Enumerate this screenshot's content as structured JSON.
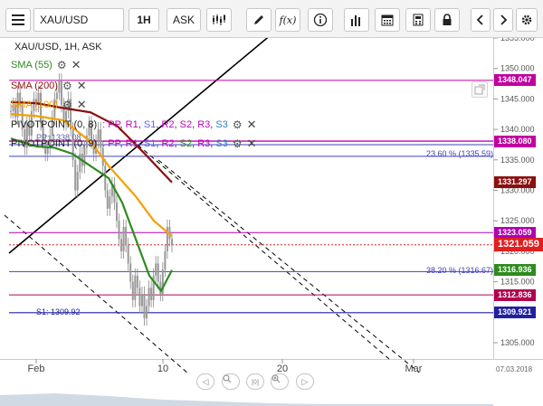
{
  "toolbar": {
    "symbol": "XAU/USD",
    "timeframe": "1H",
    "price_type": "ASK",
    "fx_label": "f(x)"
  },
  "chart_title": "XAU/USD, 1H, ASK",
  "indicators": [
    {
      "label": "SMA (55)",
      "color": "#2e8b1e"
    },
    {
      "label": "SMA (200)",
      "color": "#8b1010"
    },
    {
      "label": "SMA (100)",
      "color": "#f5a000"
    },
    {
      "label_prefix": "PIVOTPOINT (0, 8)",
      "parts": [
        ":",
        "PP",
        "R1",
        "S1",
        "R2",
        "S2",
        "R3",
        "S3"
      ],
      "color": "#c000c0"
    },
    {
      "label_prefix": "PIVOTPOINT (0, 9)",
      "parts": [
        ":",
        "PP",
        "R1",
        "S1",
        "R2",
        "S2",
        "R3",
        "S3"
      ],
      "color": "#4040c0"
    }
  ],
  "pivot_parts_colors": {
    ":": "#c000c0",
    "PP": "#c000c0",
    "R1": "#c000c0",
    "S1": "#6060ff",
    "R2": "#c000c0",
    "S2": "#c000c0",
    "R3": "#c000c0",
    "S3": "#3080c0"
  },
  "annotations": {
    "pp_label": "PP: 1338.08",
    "s1_label": "S1: 1309.92",
    "fib_2360": "23.60 % (1335.59)",
    "fib_3820": "38.20 % (1316.67)"
  },
  "price_axis": {
    "ticks": [
      "1355.000",
      "1350.000",
      "1345.000",
      "1340.000",
      "1335.000",
      "1330.000",
      "1325.000",
      "1320.000",
      "1315.000",
      "1310.000",
      "1305.000"
    ],
    "tick_values": [
      1355,
      1350,
      1345,
      1340,
      1335,
      1330,
      1325,
      1320,
      1315,
      1310,
      1305
    ]
  },
  "price_labels": [
    {
      "value": "1348.047",
      "price": 1348.047,
      "color": "#c000a0"
    },
    {
      "value": "1338.080",
      "price": 1338.08,
      "color": "#c000a0"
    },
    {
      "value": "1331.297",
      "price": 1331.297,
      "color": "#8b1010"
    },
    {
      "value": "1323.059",
      "price": 1323.059,
      "color": "#b000b0"
    },
    {
      "value": "1321.059",
      "price": 1321.059,
      "color": "#e02020",
      "current": true
    },
    {
      "value": "1316.936",
      "price": 1316.936,
      "color": "#2e8b1e"
    },
    {
      "value": "1312.836",
      "price": 1312.836,
      "color": "#b00050"
    },
    {
      "value": "1309.921",
      "price": 1309.921,
      "color": "#2020a0"
    }
  ],
  "time_axis": {
    "labels": [
      "Feb",
      "10",
      "20",
      "Mar"
    ],
    "date_stamp": "07.03.2018"
  },
  "colors": {
    "sma55": "#2e8b1e",
    "sma100": "#f5a000",
    "sma200": "#8b1010",
    "candles": "#888888"
  }
}
